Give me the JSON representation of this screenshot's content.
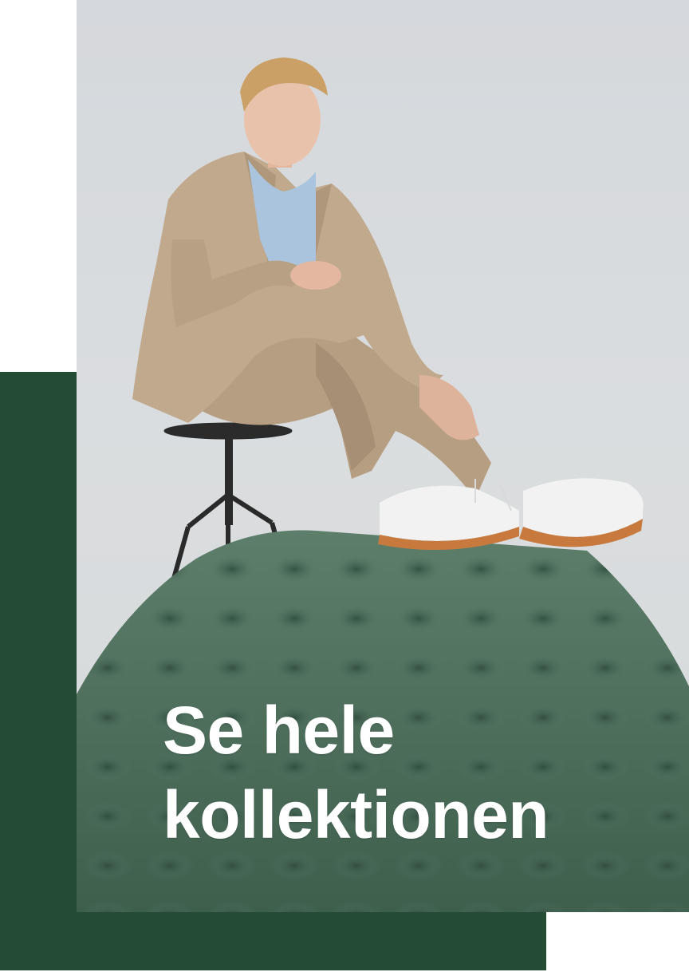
{
  "banner": {
    "cta_line1": "Se hele",
    "cta_line2": "kollektionen"
  },
  "colors": {
    "accent_green": "#244b33",
    "background": "#ffffff",
    "text": "#ffffff"
  },
  "photo": {
    "icon": "fashion-photo"
  }
}
